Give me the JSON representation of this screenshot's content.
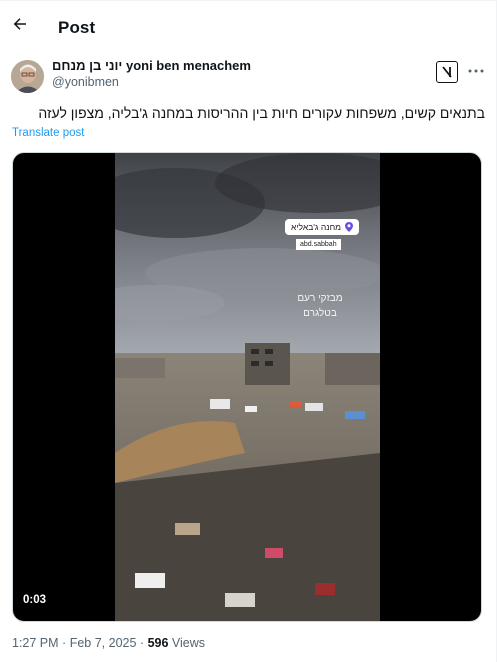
{
  "header": {
    "title": "Post"
  },
  "author": {
    "display_name": "יוני בן מנחם yoni ben menachem",
    "handle": "@yonibmen"
  },
  "post": {
    "text": "בתנאים קשים, משפחות עקורים חיות בין ההריסות במחנה ג'בליה, מצפון לעזה",
    "translate_label": "Translate post"
  },
  "video": {
    "duration": "0:03",
    "location_sticker": "מחנה ג'באליא",
    "user_tag": "abd.sabbah",
    "overlay_line1": "מבזקי רעם",
    "overlay_line2": "בטלגרם"
  },
  "meta": {
    "time": "1:27 PM",
    "separator": "·",
    "date": "Feb 7, 2025",
    "views_count": "596",
    "views_label": "Views"
  },
  "colors": {
    "link": "#1d9bf0",
    "secondary_text": "#536471",
    "primary_text": "#0f1419"
  },
  "icons": {
    "back": "arrow-left-icon",
    "grok": "grok-icon",
    "more": "more-horizontal-icon",
    "location": "location-pin-icon"
  }
}
